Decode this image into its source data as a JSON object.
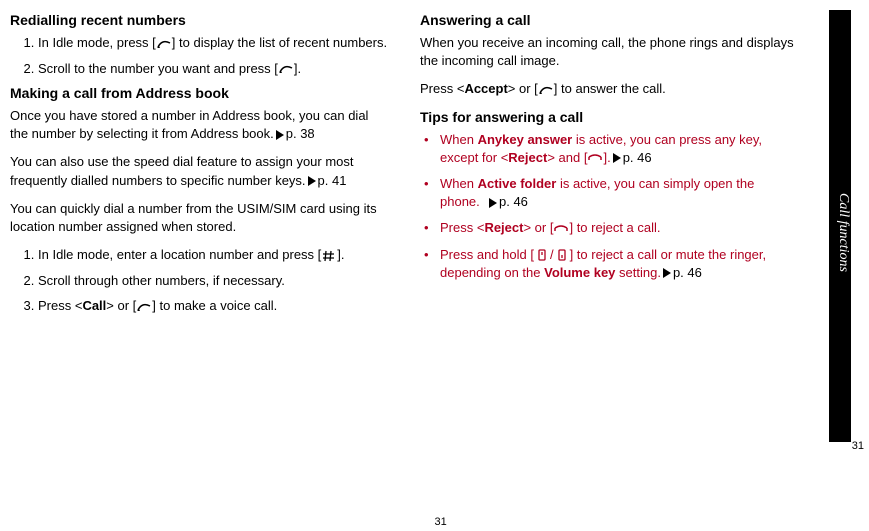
{
  "sideTab": "Call functions",
  "pageNum": "31",
  "left": {
    "h1": "Redialling recent numbers",
    "ol1": [
      "In Idle mode, press [",
      "] to display the list of recent numbers.",
      "Scroll to the number you want and press [",
      "]."
    ],
    "h2": "Making a call from Address book",
    "p1": "Once you have stored a number in Address book, you can dial the number by selecting it from Address book.",
    "p1ref": "p. 38",
    "p2": "You can also use the speed dial feature to assign your most frequently dialled numbers to specific number keys.",
    "p2ref": "p. 41",
    "p3": "You can quickly dial a number from the USIM/SIM card using its location number assigned when stored.",
    "ol2": [
      "In Idle mode, enter a location number and press [",
      "].",
      "Scroll through other numbers, if necessary.",
      "Press <",
      "Call",
      "> or [",
      "] to make a voice call."
    ]
  },
  "right": {
    "h1": "Answering a call",
    "p1": "When you receive an incoming call, the phone rings and displays the incoming call image.",
    "p2a": "Press <",
    "p2b": "Accept",
    "p2c": "> or [",
    "p2d": "] to answer the call.",
    "h2": "Tips for answering a call",
    "t1a": "When ",
    "t1b": "Anykey answer",
    "t1c": " is active, you can press any key, except for <",
    "t1d": "Reject",
    "t1e": "> and [",
    "t1f": "].",
    "t1ref": "p. 46",
    "t2a": "When ",
    "t2b": "Active folder",
    "t2c": " is active, you can simply open the phone.",
    "t2ref": "p. 46",
    "t3a": "Press <",
    "t3b": "Reject",
    "t3c": "> or [",
    "t3d": "] to reject a call.",
    "t4a": "Press and hold [",
    "t4b": "/",
    "t4c": "] to reject a call or mute the ringer, depending on the ",
    "t4d": "Volume key",
    "t4e": " setting.",
    "t4ref": "p. 46"
  }
}
